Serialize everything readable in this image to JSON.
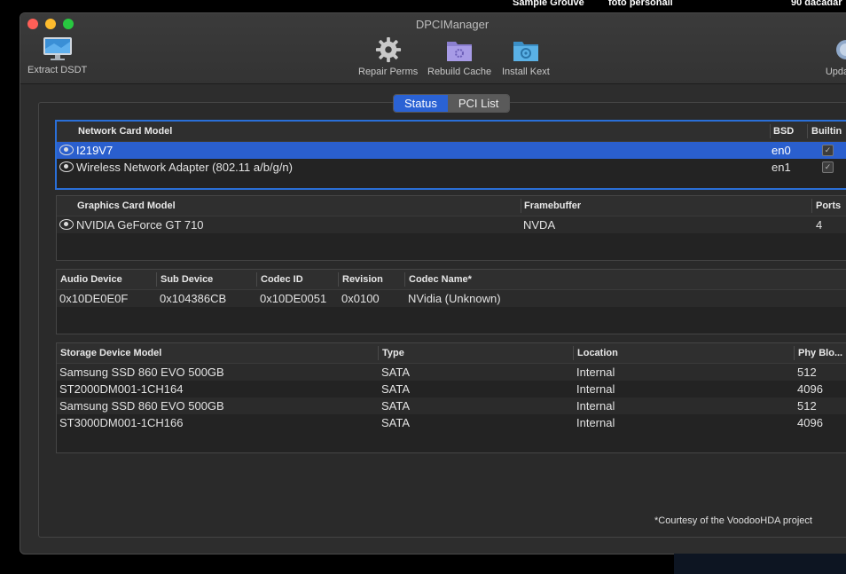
{
  "desktop": {
    "labels": [
      "Sample Grouve",
      "foto personali",
      "90 dacadar"
    ]
  },
  "window": {
    "title": "DPCIManager"
  },
  "toolbar": {
    "extract": "Extract DSDT",
    "repair": "Repair Perms",
    "rebuild": "Rebuild Cache",
    "install": "Install Kext",
    "update": "Upda"
  },
  "tabs": {
    "status": "Status",
    "pci": "PCI List"
  },
  "network": {
    "headers": [
      "Network Card Model",
      "BSD",
      "Builtin"
    ],
    "rows": [
      {
        "model": "I219V7",
        "bsd": "en0",
        "builtin": true
      },
      {
        "model": "Wireless Network Adapter (802.11 a/b/g/n)",
        "bsd": "en1",
        "builtin": true
      }
    ]
  },
  "graphics": {
    "headers": [
      "Graphics Card Model",
      "Framebuffer",
      "Ports"
    ],
    "rows": [
      {
        "model": "NVIDIA GeForce GT 710",
        "framebuffer": "NVDA",
        "ports": "4"
      }
    ]
  },
  "audio": {
    "headers": [
      "Audio Device",
      "Sub Device",
      "Codec ID",
      "Revision",
      "Codec Name*"
    ],
    "rows": [
      {
        "device": "0x10DE0E0F",
        "sub": "0x104386CB",
        "codec": "0x10DE0051",
        "rev": "0x0100",
        "name": "NVidia (Unknown)"
      }
    ]
  },
  "storage": {
    "headers": [
      "Storage Device Model",
      "Type",
      "Location",
      "Phy Blo..."
    ],
    "rows": [
      {
        "model": "Samsung SSD 860 EVO 500GB",
        "type": "SATA",
        "loc": "Internal",
        "blk": "512"
      },
      {
        "model": "ST2000DM001-1CH164",
        "type": "SATA",
        "loc": "Internal",
        "blk": "4096"
      },
      {
        "model": "Samsung SSD 860 EVO 500GB",
        "type": "SATA",
        "loc": "Internal",
        "blk": "512"
      },
      {
        "model": "ST3000DM001-1CH166",
        "type": "SATA",
        "loc": "Internal",
        "blk": "4096"
      }
    ]
  },
  "footnote": "*Courtesy of the VoodooHDA project"
}
